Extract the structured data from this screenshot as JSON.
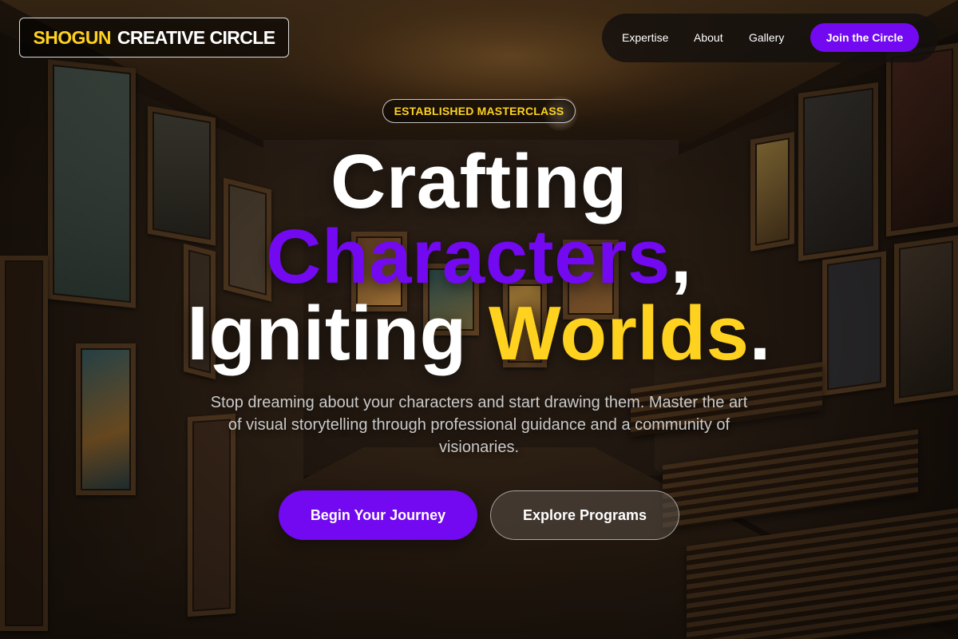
{
  "brand": {
    "accent": "SHOGUN",
    "name": "CREATIVE CIRCLE"
  },
  "nav": {
    "links": [
      "Expertise",
      "About",
      "Gallery"
    ],
    "cta": "Join the Circle"
  },
  "hero": {
    "badge": "ESTABLISHED MASTERCLASS",
    "line1": "Crafting",
    "line2_word": "Characters",
    "line2_punct": ",",
    "line3_word1": "Igniting",
    "line3_word2": "Worlds",
    "line3_punct": ".",
    "subtitle": "Stop dreaming about your characters and start drawing them. Master the art of visual storytelling through professional guidance and a community of visionaries.",
    "primary_button": "Begin Your Journey",
    "secondary_button": "Explore Programs"
  },
  "colors": {
    "accent_purple": "#7209f0",
    "accent_yellow": "#ffd21f"
  }
}
